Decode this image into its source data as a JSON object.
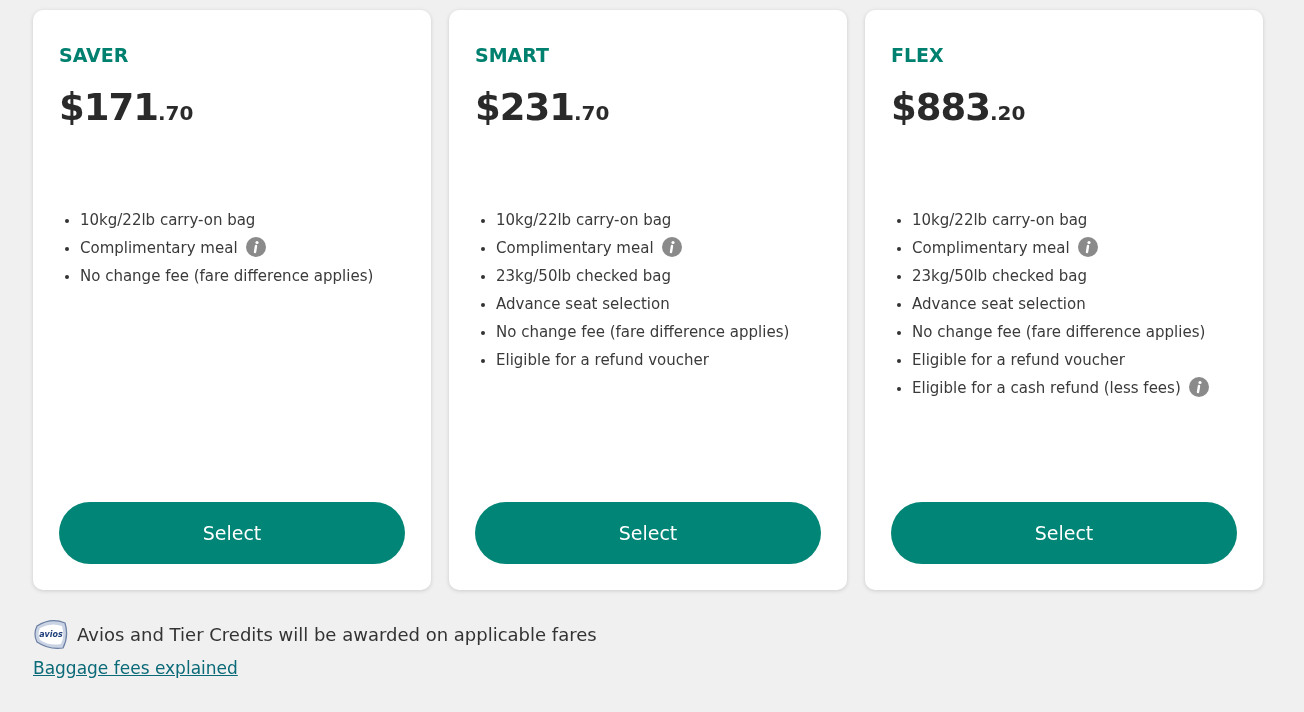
{
  "fares": [
    {
      "name": "SAVER",
      "price_whole": "$171",
      "price_cents": ".70",
      "features": [
        {
          "text": "10kg/22lb carry-on bag",
          "info": false
        },
        {
          "text": "Complimentary meal",
          "info": true
        },
        {
          "text": "No change fee (fare difference applies)",
          "info": false
        }
      ],
      "button": "Select"
    },
    {
      "name": "SMART",
      "price_whole": "$231",
      "price_cents": ".70",
      "features": [
        {
          "text": "10kg/22lb carry-on bag",
          "info": false
        },
        {
          "text": "Complimentary meal",
          "info": true
        },
        {
          "text": "23kg/50lb checked bag",
          "info": false
        },
        {
          "text": "Advance seat selection",
          "info": false
        },
        {
          "text": "No change fee (fare difference applies)",
          "info": false
        },
        {
          "text": "Eligible for a refund voucher",
          "info": false
        }
      ],
      "button": "Select"
    },
    {
      "name": "FLEX",
      "price_whole": "$883",
      "price_cents": ".20",
      "features": [
        {
          "text": "10kg/22lb carry-on bag",
          "info": false
        },
        {
          "text": "Complimentary meal",
          "info": true
        },
        {
          "text": "23kg/50lb checked bag",
          "info": false
        },
        {
          "text": "Advance seat selection",
          "info": false
        },
        {
          "text": "No change fee (fare difference applies)",
          "info": false
        },
        {
          "text": "Eligible for a refund voucher",
          "info": false
        },
        {
          "text": "Eligible for a cash refund (less fees)",
          "info": true
        }
      ],
      "button": "Select"
    }
  ],
  "avios": {
    "logo_text": "avios",
    "note": "Avios and Tier Credits will be awarded on applicable fares"
  },
  "link": "Baggage fees explained"
}
